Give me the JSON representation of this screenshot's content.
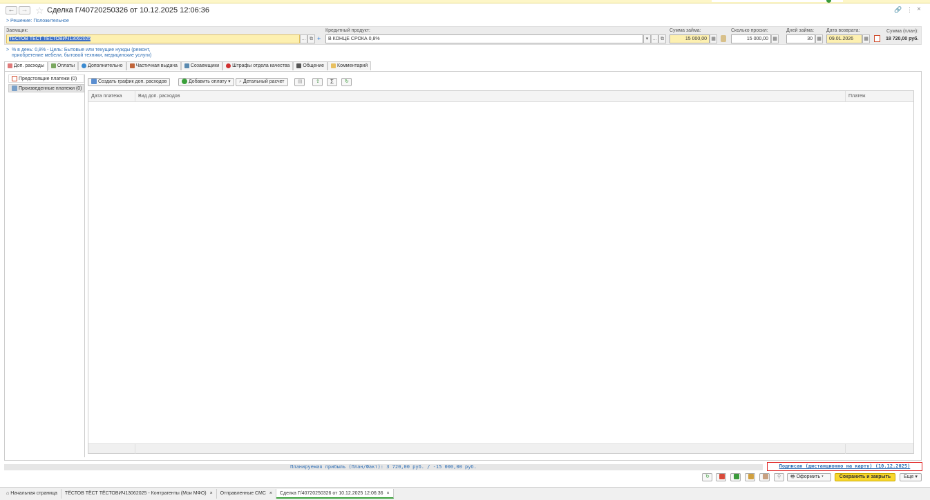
{
  "window": {
    "title": "Сделка Г/40720250326 от 10.12.2025 12:06:36"
  },
  "decision": "Решение: Положительное",
  "fields": {
    "borrower_label": "Заемщик:",
    "borrower_value": "ТЁСТОВ ТЁСТ ТЁСТОВИЧ13062025",
    "product_label": "Кредитный продукт:",
    "product_value": "В КОНЦЕ СРОКА 0,8%",
    "loan_sum_label": "Сумма займа:",
    "loan_sum_value": "15 000,00",
    "asked_label": "Сколько просил:",
    "asked_value": "15 000,00",
    "days_label": "Дней займа:",
    "days_value": "30",
    "return_label": "Дата возврата:",
    "return_value": "09.01.2026",
    "plan_label": "Сумма (план):",
    "plan_value": "18 720,00 руб."
  },
  "rate_info": "% в день: 0,8% - Цель: Бытовые или текущие нужды (ремонт, приобретение мебели, бытовой техники, медицинские услуги)",
  "tabs": [
    "Доп. расходы",
    "Оплаты",
    "Дополнительно",
    "Частичная выдача",
    "Созаемщики",
    "Штрафы отдела качества",
    "Общение",
    "Комментарий"
  ],
  "side_list": {
    "upcoming": "Предстоящие платежи (0)",
    "done": "Произведенные платежи (0)"
  },
  "toolbar": {
    "create_schedule": "Создать график доп. расходов",
    "add_payment": "Добавить оплату",
    "detail_calc": "Детальный расчет"
  },
  "table": {
    "col_date": "Дата платежа",
    "col_type": "Вид доп. расходов",
    "col_payment": "Платеж"
  },
  "footer": {
    "profit": "Планируемая прибыль (План/Факт): 3 720,00 руб. / -15 000,00 руб.",
    "signed": "Подписан (дистанционно на карту) (10.12.2025)",
    "format_btn": "Оформить",
    "save_close": "Сохранить и закрыть",
    "more": "Еще"
  },
  "bottom_tabs": [
    "Начальная страница",
    "ТЁСТОВ ТЁСТ ТЁСТОВИЧ13062025 - Контрагенты (Мои МФО)",
    "Отправленные СМС",
    "Сделка Г/40720250326 от 10.12.2025 12:06:36"
  ],
  "colors": {
    "accent_yellow": "#fdf0b0",
    "save_button": "#f7d62d",
    "link_blue": "#2f6fb5",
    "signed_border": "#e02020"
  }
}
